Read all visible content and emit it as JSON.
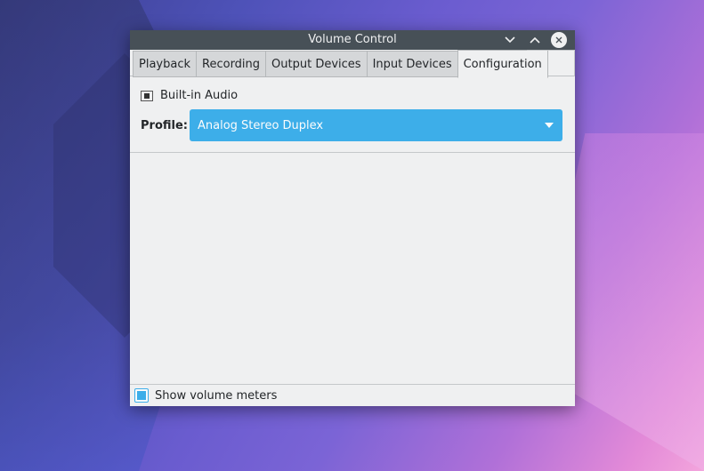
{
  "window": {
    "title": "Volume Control",
    "controls": {
      "minimize": "chevron-down-icon",
      "maximize": "chevron-up-icon",
      "close": "close-icon"
    }
  },
  "tabs": [
    {
      "label": "Playback",
      "active": false
    },
    {
      "label": "Recording",
      "active": false
    },
    {
      "label": "Output Devices",
      "active": false
    },
    {
      "label": "Input Devices",
      "active": false
    },
    {
      "label": "Configuration",
      "active": true
    }
  ],
  "configuration": {
    "card_name": "Built-in Audio",
    "card_icon": "sound-card-icon",
    "profile_label": "Profile:",
    "profile_value": "Analog Stereo Duplex"
  },
  "footer": {
    "show_meters_label": "Show volume meters",
    "show_meters_checked": true
  },
  "colors": {
    "accent": "#3daee9",
    "titlebar": "#475057",
    "window_bg": "#eff0f1"
  }
}
